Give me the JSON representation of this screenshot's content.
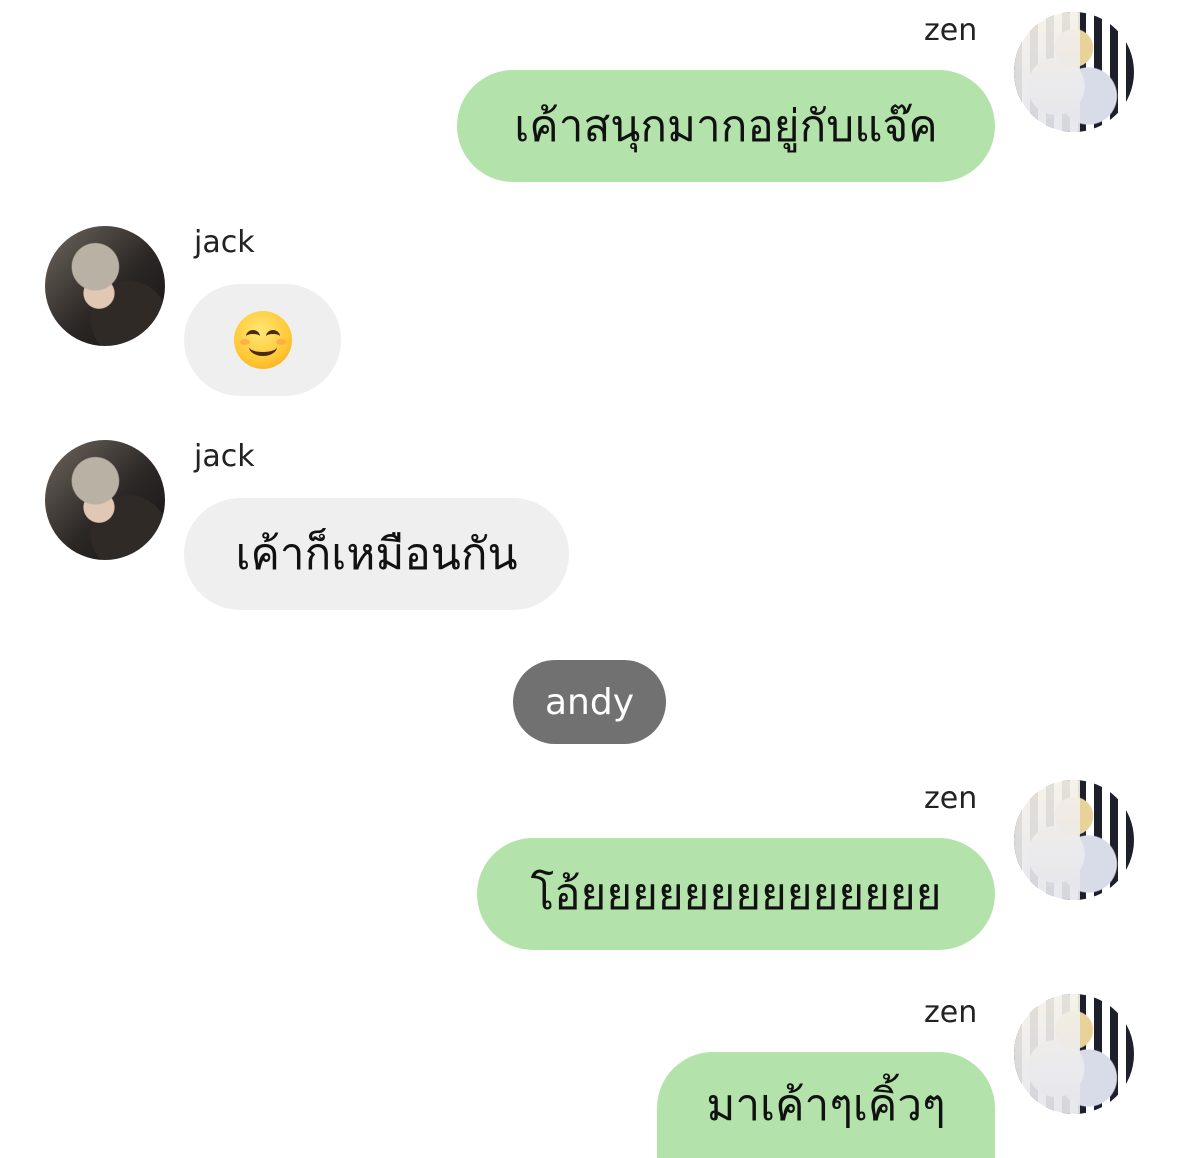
{
  "messages": [
    {
      "sender": "zen",
      "text": "เค้าสนุกมากอยู่กับแจ๊ค"
    },
    {
      "sender": "jack",
      "text": "",
      "emoji": "smiling-face-icon"
    },
    {
      "sender": "jack",
      "text": "เค้าก็เหมือนกัน"
    },
    {
      "system": "andy"
    },
    {
      "sender": "zen",
      "text": "โอ้ยยยยยยยยยยยยยย"
    },
    {
      "sender": "zen",
      "text": "มาเค้าๆเคิ้วๆ"
    }
  ],
  "colors": {
    "outgoing_bubble": "#b3e3ab",
    "incoming_bubble": "#efefef",
    "system_bubble": "#717171"
  }
}
